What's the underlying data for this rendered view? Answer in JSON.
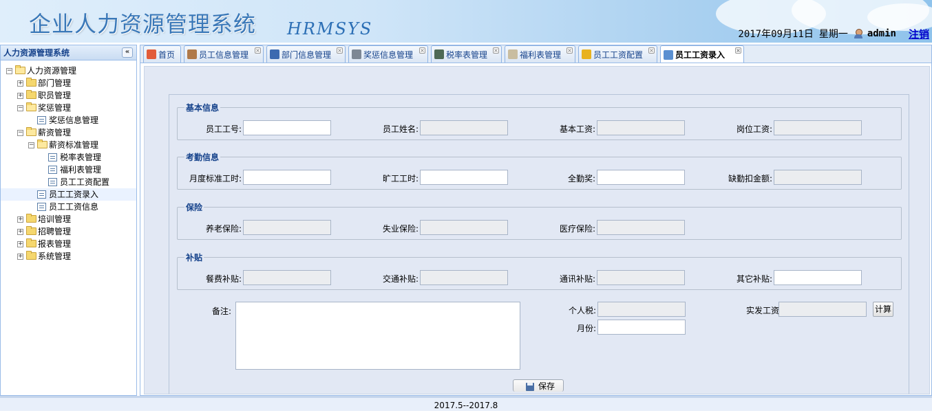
{
  "header": {
    "title": "企业人力资源管理系统",
    "subtitle": "HRMSYS",
    "date": "2017年09月11日",
    "weekday": "星期一",
    "user": "admin",
    "logout": "注销"
  },
  "sidebar": {
    "title": "人力资源管理系统",
    "collapse_glyph": "«",
    "tree": [
      {
        "label": "人力资源管理",
        "level": 0,
        "type": "folder",
        "open": true
      },
      {
        "label": "部门管理",
        "level": 1,
        "type": "folder",
        "open": false
      },
      {
        "label": "职员管理",
        "level": 1,
        "type": "folder",
        "open": false
      },
      {
        "label": "奖惩管理",
        "level": 1,
        "type": "folder",
        "open": true
      },
      {
        "label": "奖惩信息管理",
        "level": 2,
        "type": "file"
      },
      {
        "label": "薪资管理",
        "level": 1,
        "type": "folder",
        "open": true
      },
      {
        "label": "薪资标准管理",
        "level": 2,
        "type": "folder",
        "open": true
      },
      {
        "label": "税率表管理",
        "level": 3,
        "type": "file"
      },
      {
        "label": "福利表管理",
        "level": 3,
        "type": "file"
      },
      {
        "label": "员工工资配置",
        "level": 3,
        "type": "file"
      },
      {
        "label": "员工工资录入",
        "level": 2,
        "type": "file",
        "selected": true
      },
      {
        "label": "员工工资信息",
        "level": 2,
        "type": "file"
      },
      {
        "label": "培训管理",
        "level": 1,
        "type": "folder",
        "open": false
      },
      {
        "label": "招聘管理",
        "level": 1,
        "type": "folder",
        "open": false
      },
      {
        "label": "报表管理",
        "level": 1,
        "type": "folder",
        "open": false
      },
      {
        "label": "系统管理",
        "level": 1,
        "type": "folder",
        "open": false
      }
    ]
  },
  "tabs": [
    {
      "label": "首页",
      "icon": "home-icon",
      "closable": false
    },
    {
      "label": "员工信息管理",
      "icon": "user-icon",
      "closable": true
    },
    {
      "label": "部门信息管理",
      "icon": "monitor-icon",
      "closable": true
    },
    {
      "label": "奖惩信息管理",
      "icon": "form-icon",
      "closable": true
    },
    {
      "label": "税率表管理",
      "icon": "table-icon",
      "closable": true
    },
    {
      "label": "福利表管理",
      "icon": "scroll-icon",
      "closable": true
    },
    {
      "label": "员工工资配置",
      "icon": "config-icon",
      "closable": true
    },
    {
      "label": "员工工资录入",
      "icon": "edit-icon",
      "closable": true,
      "active": true
    }
  ],
  "form": {
    "basic": {
      "legend": "基本信息",
      "fields": [
        {
          "label": "员工工号:",
          "value": "",
          "readonly": false
        },
        {
          "label": "员工姓名:",
          "value": "",
          "readonly": true
        },
        {
          "label": "基本工资:",
          "value": "",
          "readonly": true
        },
        {
          "label": "岗位工资:",
          "value": "",
          "readonly": true
        }
      ]
    },
    "attendance": {
      "legend": "考勤信息",
      "fields": [
        {
          "label": "月度标准工时:",
          "value": "",
          "readonly": false
        },
        {
          "label": "旷工工时:",
          "value": "",
          "readonly": false
        },
        {
          "label": "全勤奖:",
          "value": "",
          "readonly": false
        },
        {
          "label": "缺勤扣金额:",
          "value": "",
          "readonly": true
        }
      ]
    },
    "insurance": {
      "legend": "保险",
      "fields": [
        {
          "label": "养老保险:",
          "value": "",
          "readonly": true
        },
        {
          "label": "失业保险:",
          "value": "",
          "readonly": true
        },
        {
          "label": "医疗保险:",
          "value": "",
          "readonly": true
        }
      ]
    },
    "allowance": {
      "legend": "补贴",
      "fields": [
        {
          "label": "餐费补贴:",
          "value": "",
          "readonly": true
        },
        {
          "label": "交通补贴:",
          "value": "",
          "readonly": true
        },
        {
          "label": "通讯补贴:",
          "value": "",
          "readonly": true
        },
        {
          "label": "其它补贴:",
          "value": "",
          "readonly": false
        }
      ]
    },
    "note_label": "备注:",
    "tax_label": "个人税:",
    "month_label": "月份:",
    "net_label": "实发工资:",
    "calc_button": "计算",
    "save_button": "保存"
  },
  "footer": {
    "text": "2017.5--2017.8"
  },
  "colors": {
    "panel_header_text": "#15428b",
    "border": "#99bbe8",
    "content_bg": "#e2e8f4"
  }
}
